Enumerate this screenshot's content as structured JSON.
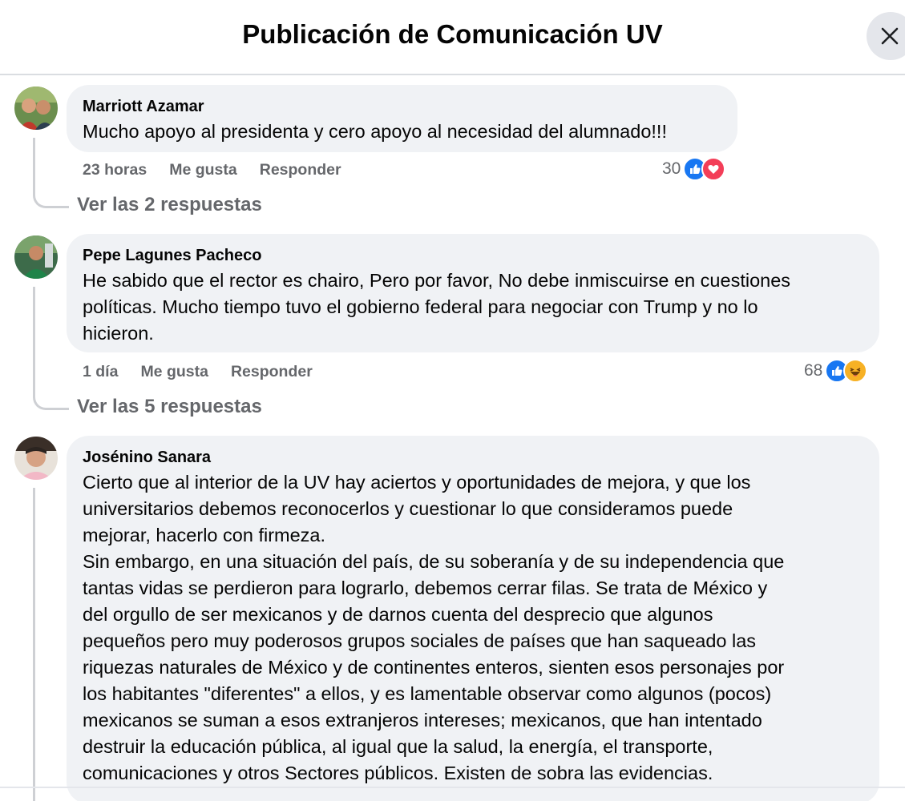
{
  "header": {
    "title": "Publicación de Comunicación UV"
  },
  "comments": [
    {
      "author": "Marriott Azamar",
      "text": "Mucho apoyo al presidenta y cero apoyo al necesidad del alumnado!!!",
      "time": "23 horas",
      "like_label": "Me gusta",
      "reply_label": "Responder",
      "reaction_count": "30",
      "reactions": [
        "like-icon",
        "love-icon"
      ],
      "view_replies": "Ver las 2 respuestas"
    },
    {
      "author": "Pepe Lagunes Pacheco",
      "text": "He sabido que el rector es chairo, Pero por favor, No debe inmiscuirse en cuestiones\npolíticas. Mucho tiempo tuvo el gobierno federal para negociar con Trump y no lo\nhicieron.",
      "time": "1 día",
      "like_label": "Me gusta",
      "reply_label": "Responder",
      "reaction_count": "68",
      "reactions": [
        "like-icon",
        "haha-icon"
      ],
      "view_replies": "Ver las 5 respuestas"
    },
    {
      "author": "Josénino Sanara",
      "text": "Cierto que al interior de la UV hay aciertos y oportunidades de mejora, y que los\nuniversitarios debemos reconocerlos y cuestionar lo que consideramos puede\nmejorar, hacerlo con firmeza.\nSin embargo, en una situación del país, de su soberanía y de su independencia que\ntantas vidas se perdieron para lograrlo, debemos cerrar filas. Se trata de México y\ndel orgullo de ser mexicanos y de darnos cuenta del desprecio que algunos\npequeños pero muy poderosos grupos sociales de países que han saqueado las\nriquezas naturales de México y de continentes enteros, sienten esos personajes por\nlos habitantes \"diferentes\" a ellos, y es lamentable observar como algunos (pocos)\nmexicanos se suman a esos extranjeros intereses; mexicanos, que han intentado\ndestruir la educación pública, al igual que la salud, la energía, el transporte,\ncomunicaciones y otros Sectores públicos. Existen de sobra las evidencias."
    }
  ],
  "colors": {
    "like": "#1877f2",
    "love": "#f33e58",
    "haha": "#f7b125",
    "bubble": "#f0f2f5",
    "secondary_text": "#65676b"
  }
}
